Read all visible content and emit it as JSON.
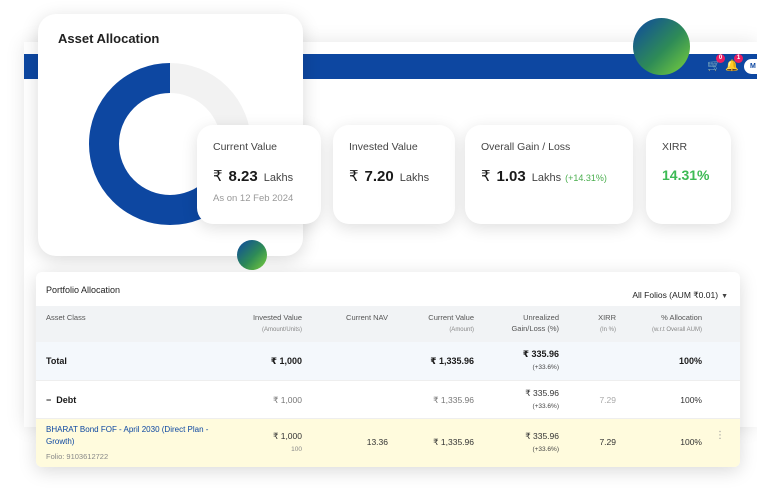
{
  "colors": {
    "brand_blue": "#0d47a1",
    "gain_green": "#4caf50",
    "xirr_green": "#3cba54",
    "highlight_row": "#fffbdd"
  },
  "topbar": {
    "cart_badge": "0",
    "bell_badge": "1",
    "profile_label": "M"
  },
  "allocation": {
    "title": "Asset Allocation",
    "debt_fraction": 0.75
  },
  "kpis": {
    "current_value": {
      "label": "Current Value",
      "currency": "₹",
      "amount": "8.23",
      "unit": "Lakhs",
      "as_on": "As on 12 Feb 2024"
    },
    "invested_value": {
      "label": "Invested Value",
      "currency": "₹",
      "amount": "7.20",
      "unit": "Lakhs"
    },
    "overall_gain": {
      "label": "Overall Gain / Loss",
      "currency": "₹",
      "amount": "1.03",
      "unit": "Lakhs",
      "pct": "(+14.31%)"
    },
    "xirr": {
      "label": "XIRR",
      "value": "14.31%"
    }
  },
  "portfolio": {
    "title": "Portfolio Allocation",
    "folio_filter": "All Folios (AUM ₹0.01)",
    "columns": {
      "asset_class": "Asset Class",
      "invested_value": "Invested Value",
      "invested_value_sub": "(Amount/Units)",
      "current_nav": "Current NAV",
      "current_value": "Current Value",
      "current_value_sub": "(Amount)",
      "unrealized": "Unrealized",
      "unrealized_sub": "Gain/Loss (%)",
      "xirr": "XIRR",
      "xirr_sub": "(In %)",
      "allocation": "% Allocation",
      "allocation_sub": "(w.r.t Overall AUM)"
    },
    "total": {
      "label": "Total",
      "invested": "₹ 1,000",
      "current_value": "₹ 1,335.96",
      "gain": "₹ 335.96",
      "gain_pct": "(+33.6%)",
      "allocation": "100%"
    },
    "debt": {
      "toggle": "−",
      "label": "Debt",
      "invested": "₹ 1,000",
      "current_value": "₹ 1,335.96",
      "gain": "₹ 335.96",
      "gain_pct": "(+33.6%)",
      "xirr": "7.29",
      "allocation": "100%"
    },
    "fund": {
      "name": "BHARAT Bond FOF - April 2030 (Direct Plan - Growth)",
      "folio": "Folio: 9103612722",
      "invested": "₹ 1,000",
      "units": "100",
      "nav": "13.36",
      "current_value": "₹ 1,335.96",
      "gain": "₹ 335.96",
      "gain_pct": "(+33.6%)",
      "xirr": "7.29",
      "allocation": "100%",
      "menu": "⋮"
    }
  }
}
